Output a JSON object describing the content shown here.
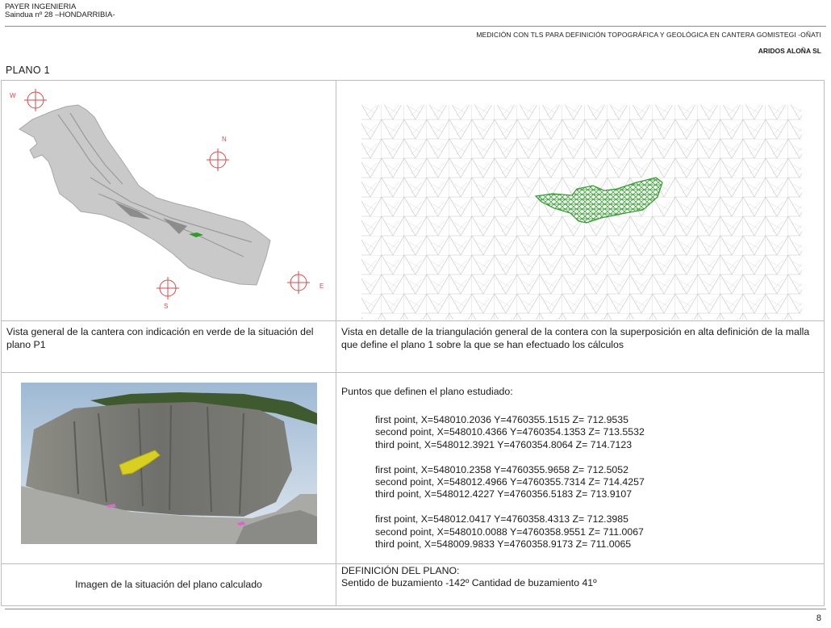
{
  "header": {
    "company": "PAYER INGENIERIA",
    "address": "Saindua nº 28 –HONDARRIBIA-",
    "project_title": "MEDICIÓN CON TLS PARA DEFINICIÓN TOPOGRÁFICA Y GEOLÓGICA EN CANTERA GOMISTEGI  -OÑATI",
    "client": "ARIDOS ALOÑA SL"
  },
  "section_title": "PLANO 1",
  "compass_labels": {
    "west": "W",
    "north": "N",
    "south": "S",
    "east": "E"
  },
  "captions": {
    "general_view": "Vista general de la cantera con indicación en verde de la situación del plano P1",
    "detail_view": "Vista en detalle de la triangulación general de la contera con la superposición en alta definición de la malla que define el plano 1 sobre la que se han efectuado los cálculos",
    "photo": "Imagen de la situación del plano calculado"
  },
  "points": {
    "heading": "Puntos que definen el plano estudiado:",
    "groups": [
      [
        "first point, X=548010.2036  Y=4760355.1515  Z= 712.9535",
        "second point, X=548010.4366  Y=4760354.1353  Z= 713.5532",
        "third point, X=548012.3921  Y=4760354.8064  Z= 714.7123"
      ],
      [
        "first point, X=548010.2358  Y=4760355.9658  Z= 712.5052",
        "second point, X=548012.4966  Y=4760355.7314  Z= 714.4257",
        "third point, X=548012.4227  Y=4760356.5183  Z= 713.9107"
      ],
      [
        "first point, X=548012.0417  Y=4760358.4313  Z= 712.3985",
        "second point, X=548010.0088  Y=4760358.9551  Z= 711.0067",
        "third point, X=548009.9833  Y=4760358.9173  Z= 711.0065"
      ]
    ]
  },
  "definition": {
    "title": "DEFINICIÓN DEL PLANO:",
    "text": "Sentido de buzamiento -142º Cantidad de buzamiento 41º"
  },
  "page_number": "8",
  "colors": {
    "rule": "#8c8c8c",
    "cell_border": "#bdbdbd",
    "compass_red": "#d94848",
    "mesh_green": "#2f9b2a",
    "plane_yellow": "#d8d020"
  }
}
